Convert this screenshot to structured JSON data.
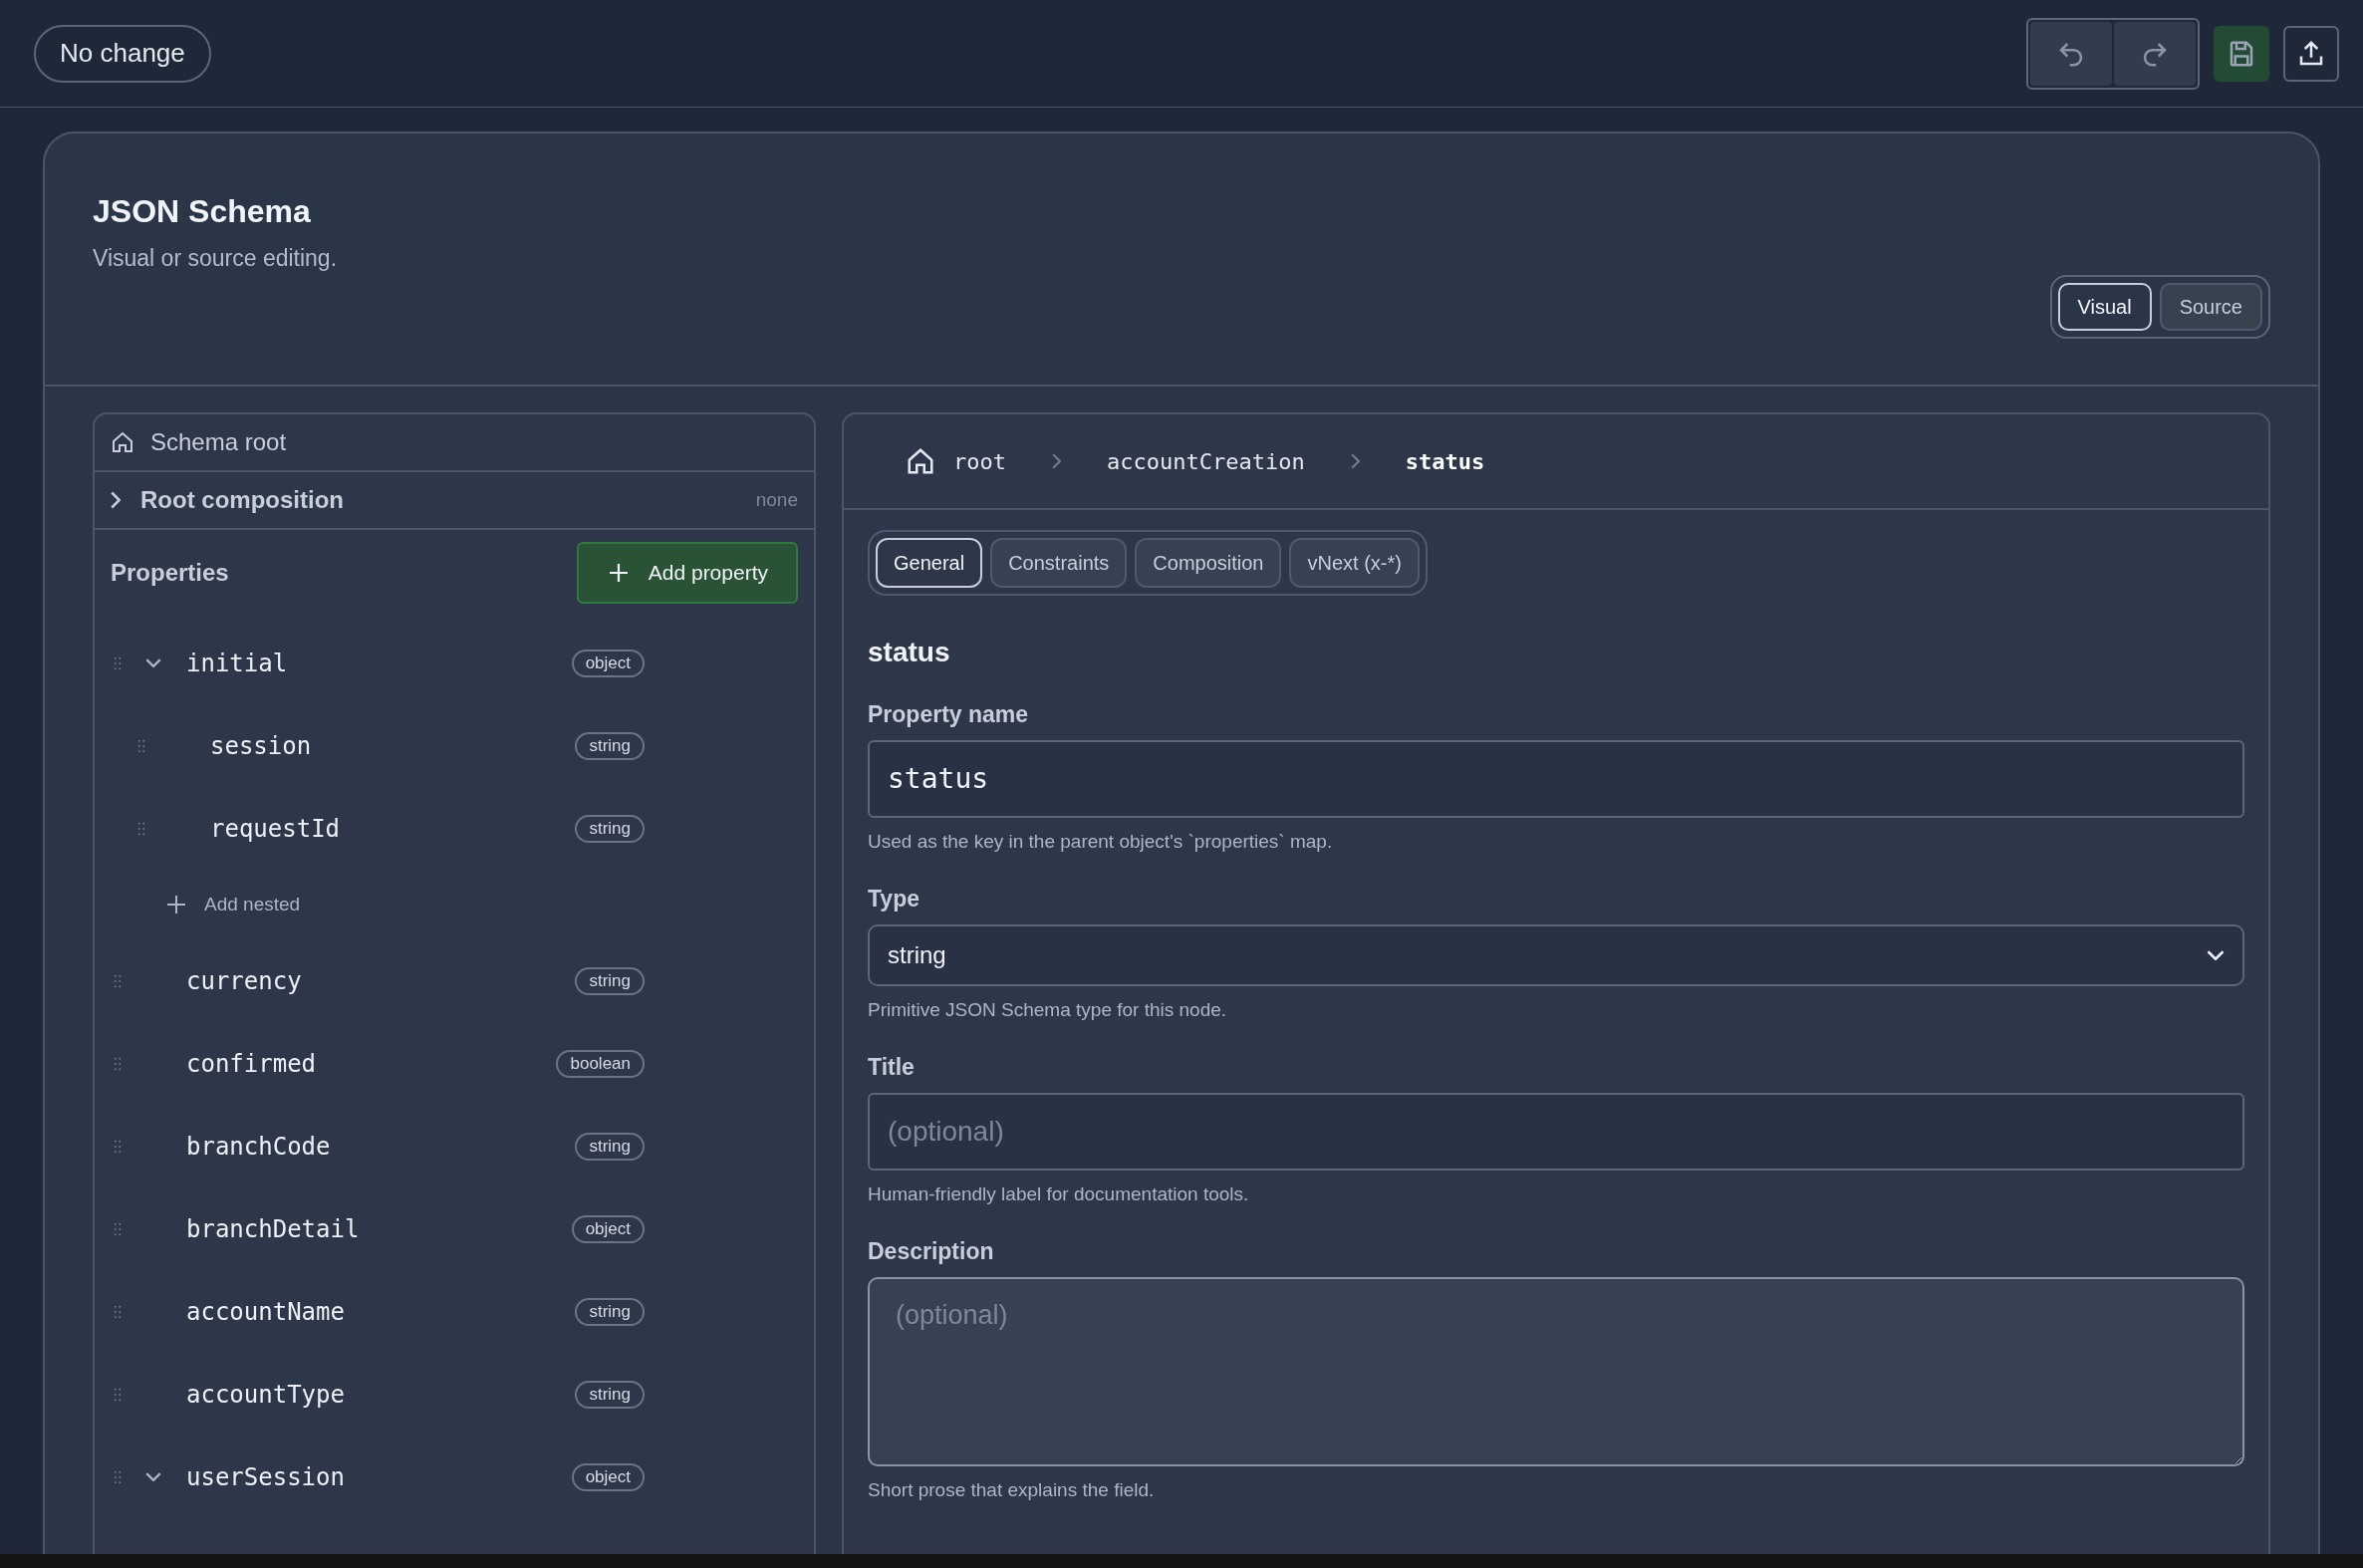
{
  "toolbar": {
    "status_button": "No change"
  },
  "header": {
    "title": "JSON Schema",
    "subtitle": "Visual or source editing."
  },
  "mode_tabs": [
    {
      "label": "Visual",
      "selected": true
    },
    {
      "label": "Source",
      "selected": false
    }
  ],
  "tree": {
    "root_label": "Schema root",
    "composition": {
      "label": "Root composition",
      "value": "none",
      "expanded": false
    },
    "properties_label": "Properties",
    "add_button": "Add property",
    "items": [
      {
        "name": "initial",
        "type": "object",
        "expanded": true,
        "add_nested": "Add nested",
        "children": [
          {
            "name": "session",
            "type": "string"
          },
          {
            "name": "requestId",
            "type": "string"
          }
        ]
      },
      {
        "name": "currency",
        "type": "string"
      },
      {
        "name": "confirmed",
        "type": "boolean"
      },
      {
        "name": "branchCode",
        "type": "string"
      },
      {
        "name": "branchDetail",
        "type": "object"
      },
      {
        "name": "accountName",
        "type": "string"
      },
      {
        "name": "accountType",
        "type": "string"
      },
      {
        "name": "userSession",
        "type": "object",
        "expanded": true
      }
    ]
  },
  "breadcrumb": [
    {
      "label": "root",
      "selected": false
    },
    {
      "label": "accountCreation",
      "selected": false
    },
    {
      "label": "status",
      "selected": true
    }
  ],
  "editor_tabs": [
    {
      "label": "General",
      "selected": true
    },
    {
      "label": "Constraints",
      "selected": false
    },
    {
      "label": "Composition",
      "selected": false
    },
    {
      "label": "vNext (x-*)",
      "selected": false
    }
  ],
  "editor": {
    "heading": "status",
    "fields": [
      {
        "kind": "text",
        "label": "Property name",
        "value": "status",
        "help": "Used as the key in the parent object's `properties` map."
      },
      {
        "kind": "select",
        "label": "Type",
        "value": "string",
        "help": "Primitive JSON Schema type for this node."
      },
      {
        "kind": "text",
        "label": "Title",
        "placeholder": "(optional)",
        "help": "Human-friendly label for documentation tools."
      },
      {
        "kind": "textarea",
        "label": "Description",
        "placeholder": "(optional)",
        "help": "Short prose that explains the field."
      }
    ]
  }
}
